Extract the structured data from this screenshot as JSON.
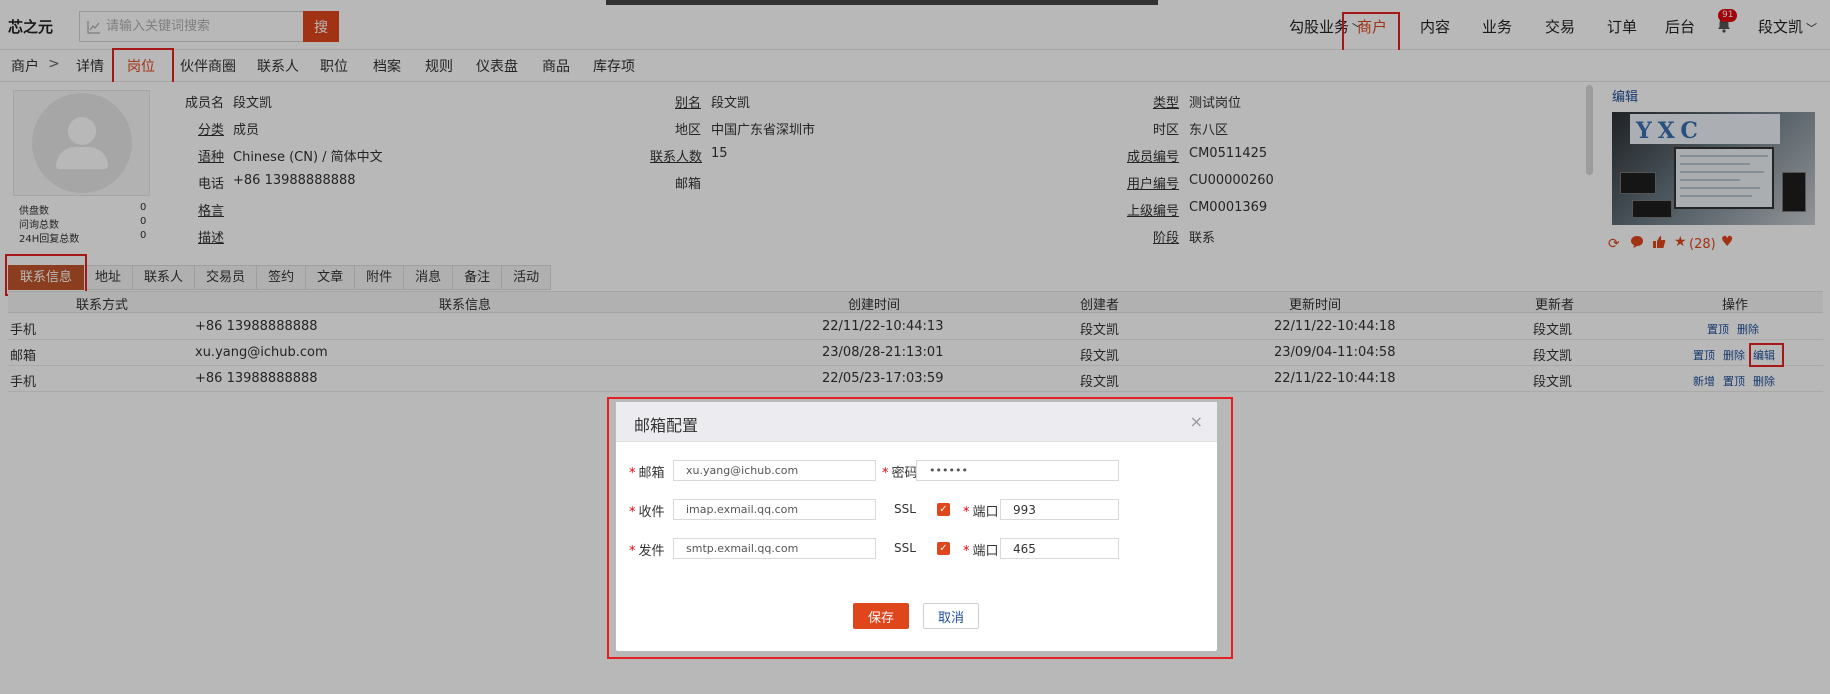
{
  "topbar": {
    "logo": "芯之元",
    "search_placeholder": "请输入关键词搜索",
    "search_button": "搜",
    "nav": [
      "勾股业务",
      "商户",
      "内容",
      "业务",
      "交易",
      "订单",
      "后台"
    ],
    "notification_count": "91",
    "user": "段文凯"
  },
  "subnav": {
    "breadcrumb_root": "商户",
    "breadcrumb_sep": ">",
    "items": [
      "详情",
      "岗位",
      "伙伴商圈",
      "联系人",
      "职位",
      "档案",
      "规则",
      "仪表盘",
      "商品",
      "库存项"
    ]
  },
  "profile": {
    "stats": [
      {
        "label": "供盘数",
        "value": "0"
      },
      {
        "label": "问询总数",
        "value": "0"
      },
      {
        "label": "24H回复总数",
        "value": "0"
      }
    ],
    "col1": [
      {
        "label": "成员名",
        "value": "段文凯"
      },
      {
        "label": "分类",
        "value": "成员"
      },
      {
        "label": "语种",
        "value": "Chinese (CN) / 简体中文"
      },
      {
        "label": "电话",
        "value": "+86 13988888888"
      },
      {
        "label": "格言",
        "value": ""
      },
      {
        "label": "描述",
        "value": ""
      }
    ],
    "col2": [
      {
        "label": "别名",
        "value": "段文凯"
      },
      {
        "label": "地区",
        "value": "中国广东省深圳市"
      },
      {
        "label": "联系人数",
        "value": "15"
      },
      {
        "label": "邮箱",
        "value": ""
      }
    ],
    "col3": [
      {
        "label": "类型",
        "value": "测试岗位"
      },
      {
        "label": "时区",
        "value": "东八区"
      },
      {
        "label": "成员编号",
        "value": "CM0511425"
      },
      {
        "label": "用户编号",
        "value": "CU00000260"
      },
      {
        "label": "上级编号",
        "value": "CM0001369"
      },
      {
        "label": "阶段",
        "value": "联系"
      }
    ],
    "edit_label": "编辑",
    "product_logo_text": "YXC",
    "likes": "(28)"
  },
  "tabs": [
    "联系信息",
    "地址",
    "联系人",
    "交易员",
    "签约",
    "文章",
    "附件",
    "消息",
    "备注",
    "活动"
  ],
  "table": {
    "headers": [
      "联系方式",
      "联系信息",
      "创建时间",
      "创建者",
      "更新时间",
      "更新者",
      "操作"
    ],
    "rows": [
      {
        "type": "手机",
        "info": "+86 13988888888",
        "created": "22/11/22-10:44:13",
        "creator": "段文凯",
        "updated": "22/11/22-10:44:18",
        "updater": "段文凯",
        "ops": [
          "置顶",
          "删除"
        ]
      },
      {
        "type": "邮箱",
        "info": "xu.yang@ichub.com",
        "created": "23/08/28-21:13:01",
        "creator": "段文凯",
        "updated": "23/09/04-11:04:58",
        "updater": "段文凯",
        "ops": [
          "置顶",
          "删除",
          "编辑"
        ]
      },
      {
        "type": "手机",
        "info": "+86 13988888888",
        "created": "22/05/23-17:03:59",
        "creator": "段文凯",
        "updated": "22/11/22-10:44:18",
        "updater": "段文凯",
        "ops": [
          "新增",
          "置顶",
          "删除"
        ]
      }
    ]
  },
  "modal": {
    "title": "邮箱配置",
    "close": "×",
    "email_label": "邮箱",
    "email_value": "xu.yang@ichub.com",
    "password_label": "密码",
    "password_value": "••••••",
    "receive_label": "收件",
    "receive_value": "imap.exmail.qq.com",
    "send_label": "发件",
    "send_value": "smtp.exmail.qq.com",
    "ssl_label": "SSL",
    "port_label": "端口",
    "receive_port": "993",
    "send_port": "465",
    "save": "保存",
    "cancel": "取消"
  },
  "colors": {
    "accent": "#e0461c",
    "highlight_box": "#e62020",
    "link": "#1f4f9a"
  }
}
